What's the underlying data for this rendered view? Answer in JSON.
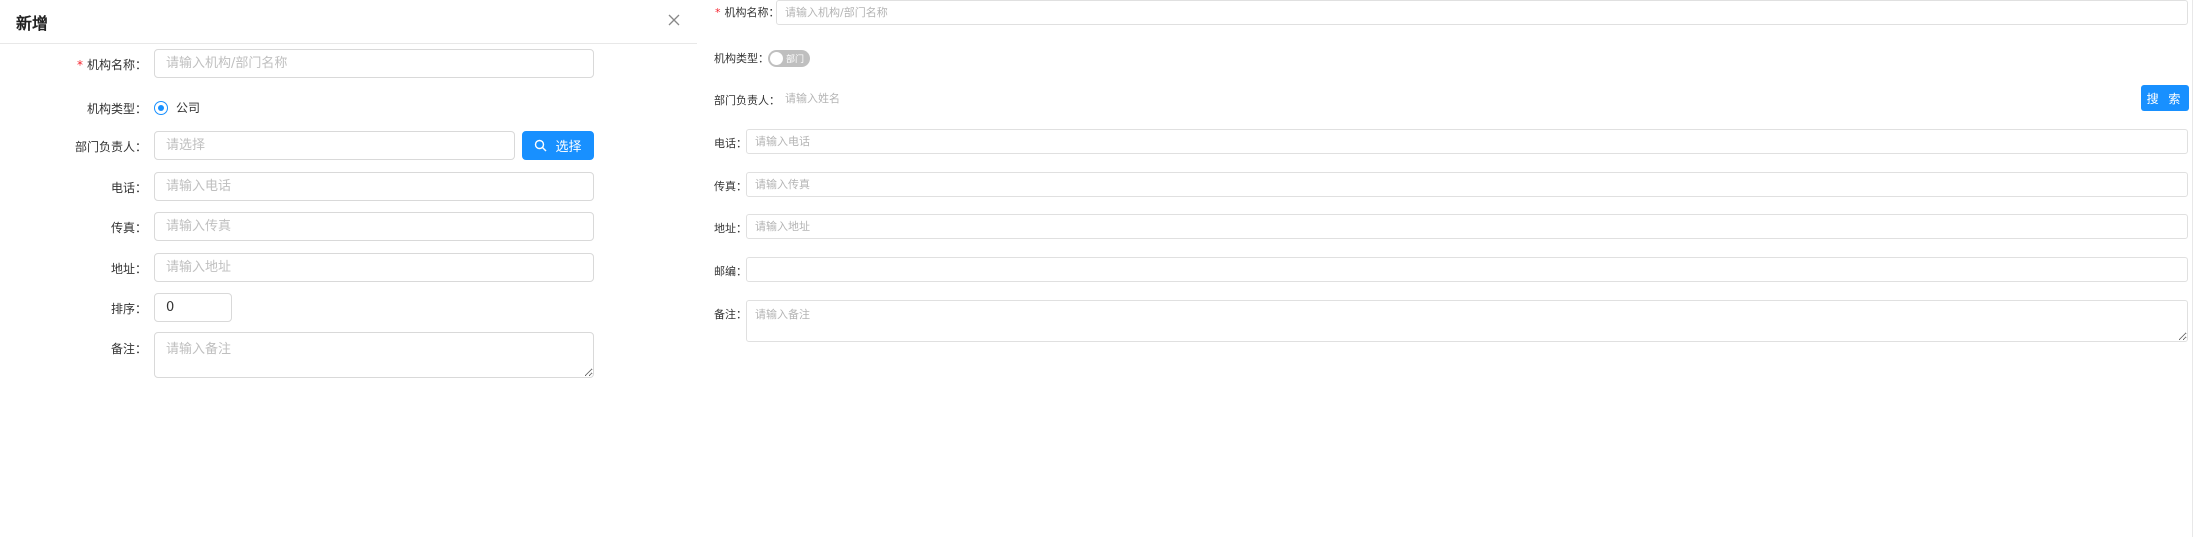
{
  "modal": {
    "title": "新增",
    "fields": {
      "org_name": {
        "required_mark": "*",
        "label": "机构名称：",
        "placeholder": "请输入机构/部门名称"
      },
      "org_type": {
        "label": "机构类型：",
        "option": "公司"
      },
      "manager": {
        "label": "部门负责人：",
        "placeholder": "请选择",
        "button": "选择"
      },
      "phone": {
        "label": "电话：",
        "placeholder": "请输入电话"
      },
      "fax": {
        "label": "传真：",
        "placeholder": "请输入传真"
      },
      "address": {
        "label": "地址：",
        "placeholder": "请输入地址"
      },
      "sort": {
        "label": "排序：",
        "value": "0"
      },
      "remark": {
        "label": "备注：",
        "placeholder": "请输入备注"
      }
    }
  },
  "panel": {
    "fields": {
      "org_name": {
        "required_mark": "*",
        "label": "机构名称：",
        "placeholder": "请输入机构/部门名称"
      },
      "org_type": {
        "label": "机构类型：",
        "switch_text": "部门"
      },
      "manager": {
        "label": "部门负责人：",
        "placeholder": "请输入姓名",
        "button": "搜 索"
      },
      "phone": {
        "label": "电话：",
        "placeholder": "请输入电话"
      },
      "fax": {
        "label": "传真：",
        "placeholder": "请输入传真"
      },
      "address": {
        "label": "地址：",
        "placeholder": "请输入地址"
      },
      "postcode": {
        "label": "邮编：",
        "placeholder": ""
      },
      "remark": {
        "label": "备注：",
        "placeholder": "请输入备注"
      }
    }
  },
  "colors": {
    "primary": "#1890ff",
    "required": "#f5222d",
    "switch_off": "#bfbfbf",
    "border": "#d9d9d9"
  },
  "icons": {
    "close": "close-icon",
    "search": "search-icon"
  }
}
